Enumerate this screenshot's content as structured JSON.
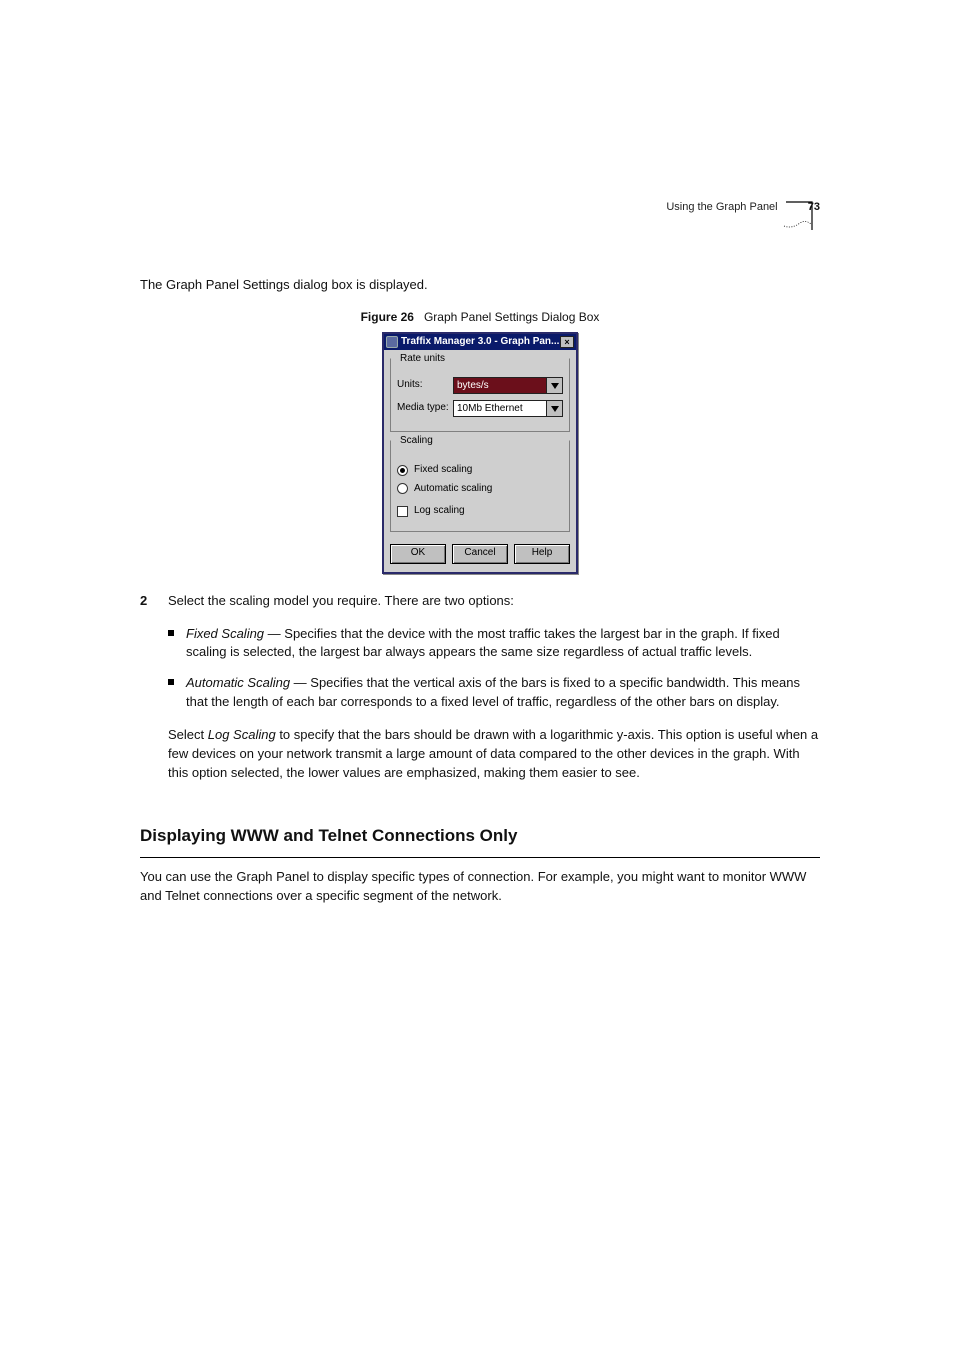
{
  "runningHeader": {
    "title": "Using the Graph Panel",
    "page": "73"
  },
  "intro": "The Graph Panel Settings dialog box is displayed.",
  "figure": {
    "label": "Figure 26",
    "caption": "Graph Panel Settings Dialog Box"
  },
  "dialog": {
    "title": "Traffix Manager 3.0 - Graph Pan...",
    "rateUnits": {
      "legend": "Rate units",
      "unitsLabel": "Units:",
      "unitsValue": "bytes/s",
      "mediaTypeLabel": "Media type:",
      "mediaTypeValue": "10Mb Ethernet"
    },
    "scaling": {
      "legend": "Scaling",
      "fixed": "Fixed scaling",
      "automatic": "Automatic scaling",
      "log": "Log scaling"
    },
    "buttons": {
      "ok": "OK",
      "cancel": "Cancel",
      "help": "Help"
    }
  },
  "step2": {
    "lead": "Select the scaling model you require. There are two options:",
    "bullets": [
      {
        "term": "Fixed Scaling",
        "rest": " — Specifies that the device with the most traffic takes the largest bar in the graph. If fixed scaling is selected, the largest bar always appears the same size regardless of actual traffic levels."
      },
      {
        "term": "Automatic Scaling",
        "rest": " — Specifies that the vertical axis of the bars is fixed to a specific bandwidth. This means that the length of each bar corresponds to a fixed level of traffic, regardless of the other bars on display."
      }
    ],
    "logPara": {
      "prefix": "Select ",
      "term": "Log Scaling",
      "rest": " to specify that the bars should be drawn with a logarithmic y-axis. This option is useful when a few devices on your network transmit a large amount of data compared to the other devices in the graph. With this option selected, the lower values are emphasized, making them easier to see."
    }
  },
  "section": {
    "title": "Displaying WWW and Telnet Connections Only",
    "para": "You can use the Graph Panel to display specific types of connection. For example, you might want to monitor WWW and Telnet connections over a specific segment of the network."
  },
  "pageFooter": ""
}
